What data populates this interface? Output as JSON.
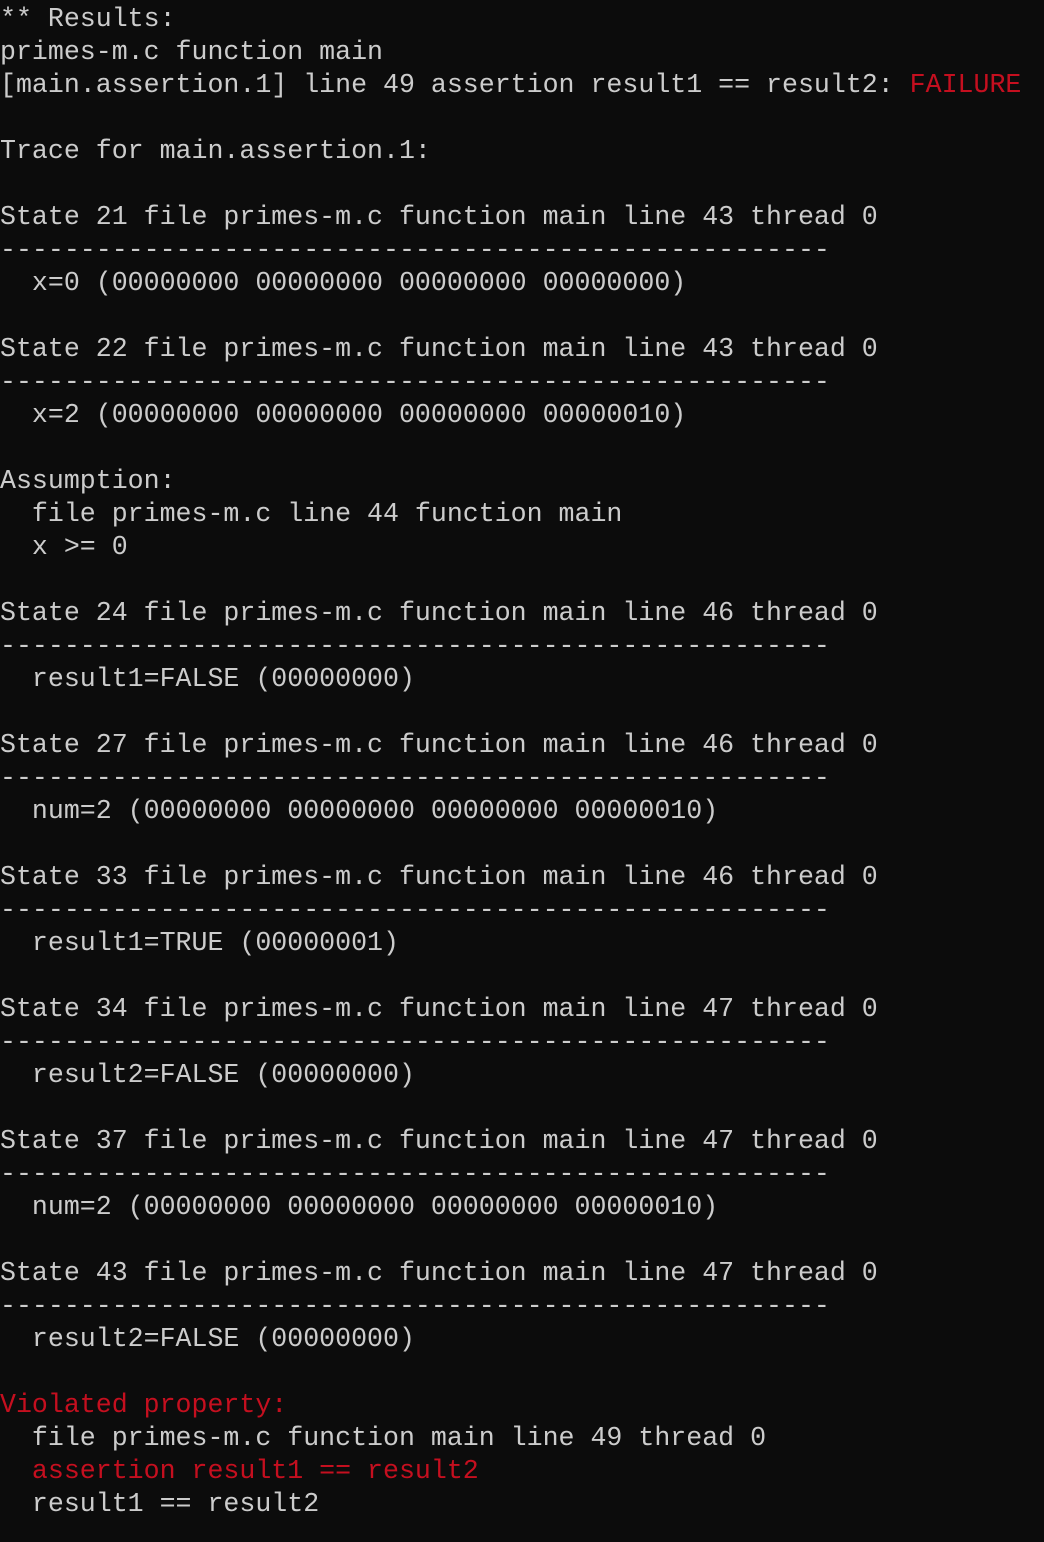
{
  "colors": {
    "background": "#0c0c0c",
    "text": "#cccccc",
    "error": "#c50f1f"
  },
  "lines": [
    [
      {
        "text": "** Results:"
      }
    ],
    [
      {
        "text": "primes-m.c function main"
      }
    ],
    [
      {
        "text": "[main.assertion.1] line 49 assertion result1 == result2: "
      },
      {
        "text": "FAILURE",
        "red": true
      }
    ],
    [],
    [
      {
        "text": "Trace for main.assertion.1:"
      }
    ],
    [],
    [
      {
        "text": "State 21 file primes-m.c function main line 43 thread 0"
      }
    ],
    [
      {
        "text": "----------------------------------------------------"
      }
    ],
    [
      {
        "text": "  x=0 (00000000 00000000 00000000 00000000)"
      }
    ],
    [],
    [
      {
        "text": "State 22 file primes-m.c function main line 43 thread 0"
      }
    ],
    [
      {
        "text": "----------------------------------------------------"
      }
    ],
    [
      {
        "text": "  x=2 (00000000 00000000 00000000 00000010)"
      }
    ],
    [],
    [
      {
        "text": "Assumption:"
      }
    ],
    [
      {
        "text": "  file primes-m.c line 44 function main"
      }
    ],
    [
      {
        "text": "  x >= 0"
      }
    ],
    [],
    [
      {
        "text": "State 24 file primes-m.c function main line 46 thread 0"
      }
    ],
    [
      {
        "text": "----------------------------------------------------"
      }
    ],
    [
      {
        "text": "  result1=FALSE (00000000)"
      }
    ],
    [],
    [
      {
        "text": "State 27 file primes-m.c function main line 46 thread 0"
      }
    ],
    [
      {
        "text": "----------------------------------------------------"
      }
    ],
    [
      {
        "text": "  num=2 (00000000 00000000 00000000 00000010)"
      }
    ],
    [],
    [
      {
        "text": "State 33 file primes-m.c function main line 46 thread 0"
      }
    ],
    [
      {
        "text": "----------------------------------------------------"
      }
    ],
    [
      {
        "text": "  result1=TRUE (00000001)"
      }
    ],
    [],
    [
      {
        "text": "State 34 file primes-m.c function main line 47 thread 0"
      }
    ],
    [
      {
        "text": "----------------------------------------------------"
      }
    ],
    [
      {
        "text": "  result2=FALSE (00000000)"
      }
    ],
    [],
    [
      {
        "text": "State 37 file primes-m.c function main line 47 thread 0"
      }
    ],
    [
      {
        "text": "----------------------------------------------------"
      }
    ],
    [
      {
        "text": "  num=2 (00000000 00000000 00000000 00000010)"
      }
    ],
    [],
    [
      {
        "text": "State 43 file primes-m.c function main line 47 thread 0"
      }
    ],
    [
      {
        "text": "----------------------------------------------------"
      }
    ],
    [
      {
        "text": "  result2=FALSE (00000000)"
      }
    ],
    [],
    [
      {
        "text": "Violated property:",
        "red": true
      }
    ],
    [
      {
        "text": "  file primes-m.c function main line 49 thread 0"
      }
    ],
    [
      {
        "text": "  assertion result1 == result2",
        "red": true
      }
    ],
    [
      {
        "text": "  result1 == result2"
      }
    ]
  ]
}
